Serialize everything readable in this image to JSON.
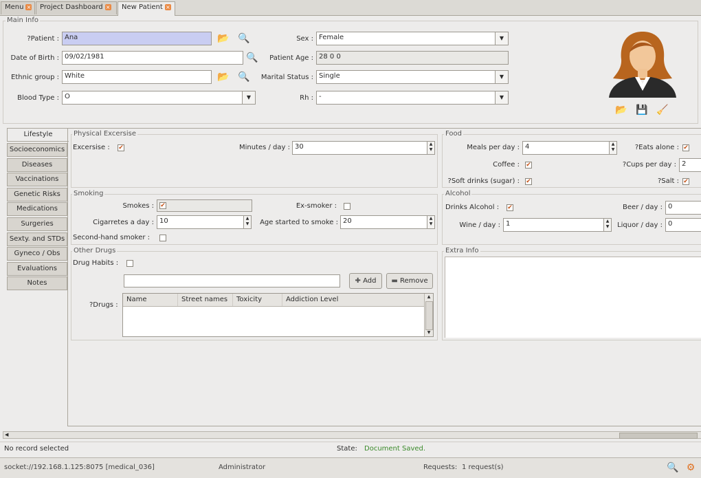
{
  "tabs": [
    {
      "label": "Menu"
    },
    {
      "label": "Project Dashboard"
    },
    {
      "label": "New Patient"
    }
  ],
  "main_info": {
    "title": "Main Info",
    "patient": {
      "label": "?Patient :",
      "value": "Ana"
    },
    "dob": {
      "label": "Date of Birth :",
      "value": "09/02/1981"
    },
    "ethnic": {
      "label": "Ethnic group :",
      "value": "White"
    },
    "blood": {
      "label": "Blood Type :",
      "value": "O"
    },
    "sex": {
      "label": "Sex :",
      "value": "Female"
    },
    "age": {
      "label": "Patient Age :",
      "value": "28 0 0"
    },
    "marital": {
      "label": "Marital Status :",
      "value": "Single"
    },
    "rh": {
      "label": "Rh :",
      "value": "-"
    }
  },
  "side_tabs": [
    "Lifestyle",
    "Socioeconomics",
    "Diseases",
    "Vaccinations",
    "Genetic Risks",
    "Medications",
    "Surgeries",
    "Sexty. and STDs",
    "Gyneco / Obs",
    "Evaluations",
    "Notes"
  ],
  "physical": {
    "title": "Physical Excersise",
    "exercise_label": "Excersise :",
    "exercise_checked": true,
    "minutes_label": "Minutes / day :",
    "minutes_value": "30"
  },
  "food": {
    "title": "Food",
    "meals_label": "Meals per day :",
    "meals_value": "4",
    "eats_alone_label": "?Eats alone :",
    "eats_alone_checked": true,
    "coffee_label": "Coffee :",
    "coffee_checked": true,
    "cups_label": "?Cups per day :",
    "cups_value": "2",
    "soft_label": "?Soft drinks (sugar) :",
    "soft_checked": true,
    "salt_label": "?Salt :",
    "salt_checked": true
  },
  "smoking": {
    "title": "Smoking",
    "smokes_label": "Smokes :",
    "smokes_checked": true,
    "exsmoker_label": "Ex-smoker :",
    "exsmoker_checked": false,
    "cigs_label": "Cigarretes a day :",
    "cigs_value": "10",
    "agestart_label": "Age started to smoke :",
    "agestart_value": "20",
    "second_label": "Second-hand smoker :",
    "second_checked": false
  },
  "alcohol": {
    "title": "Alcohol",
    "drinks_label": "Drinks Alcohol :",
    "drinks_checked": true,
    "beer_label": "Beer / day :",
    "beer_value": "0",
    "wine_label": "Wine / day :",
    "wine_value": "1",
    "liquor_label": "Liquor / day :",
    "liquor_value": "0"
  },
  "other_drugs": {
    "title": "Other Drugs",
    "habits_label": "Drug Habits :",
    "habits_checked": false,
    "search_value": "",
    "add_label": "Add",
    "remove_label": "Remove",
    "drugs_label": "?Drugs :",
    "columns": [
      "Name",
      "Street names",
      "Toxicity",
      "Addiction Level"
    ]
  },
  "extra_info": {
    "title": "Extra Info"
  },
  "status": {
    "record": "No record selected",
    "state_label": "State:",
    "state_value": "Document Saved.",
    "state_color": "#3a8a2a"
  },
  "footer": {
    "socket": "socket://192.168.1.125:8075 [medical_036]",
    "user": "Administrator",
    "requests_label": "Requests:",
    "requests_value": "1 request(s)"
  }
}
